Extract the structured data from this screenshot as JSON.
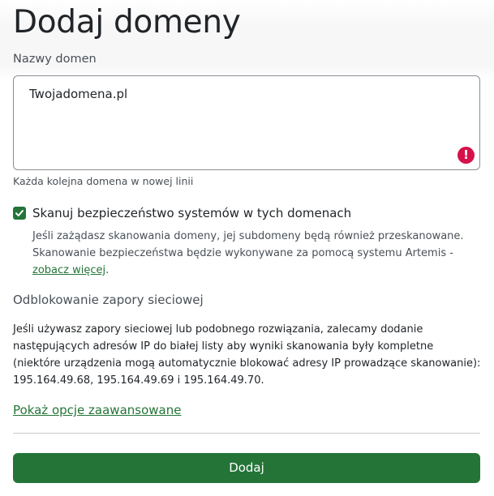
{
  "page": {
    "title": "Dodaj domeny"
  },
  "domains_field": {
    "label": "Nazwy domen",
    "value": "Twojadomena.pl",
    "help": "Każda kolejna domena w nowej linii",
    "error_icon": "exclamation-circle-icon"
  },
  "scan_option": {
    "checked": true,
    "label": "Skanuj bezpieczeństwo systemów w tych domenach",
    "desc_part1": "Jeśli zażądasz skanowania domeny, jej subdomeny będą również przeskanowane. Skanowanie bezpieczeństwa będzie wykonywane za pomocą systemu Artemis - ",
    "desc_link": "zobacz więcej",
    "desc_end": "."
  },
  "firewall": {
    "heading": "Odblokowanie zapory sieciowej",
    "body": "Jeśli używasz zapory sieciowej lub podobnego rozwiązania, zalecamy dodanie następujących adresów IP do białej listy aby wyniki skanowania były kompletne (niektóre urządzenia mogą automatycznie blokować adresy IP prowadzące skanowanie): 195.164.49.68, 195.164.49.69 i 195.164.49.70."
  },
  "advanced": {
    "link": "Pokaż opcje zaawansowane"
  },
  "submit": {
    "label": "Dodaj"
  },
  "colors": {
    "accent": "#247438",
    "error": "#d6114a",
    "text": "#212529",
    "muted": "#495057"
  }
}
